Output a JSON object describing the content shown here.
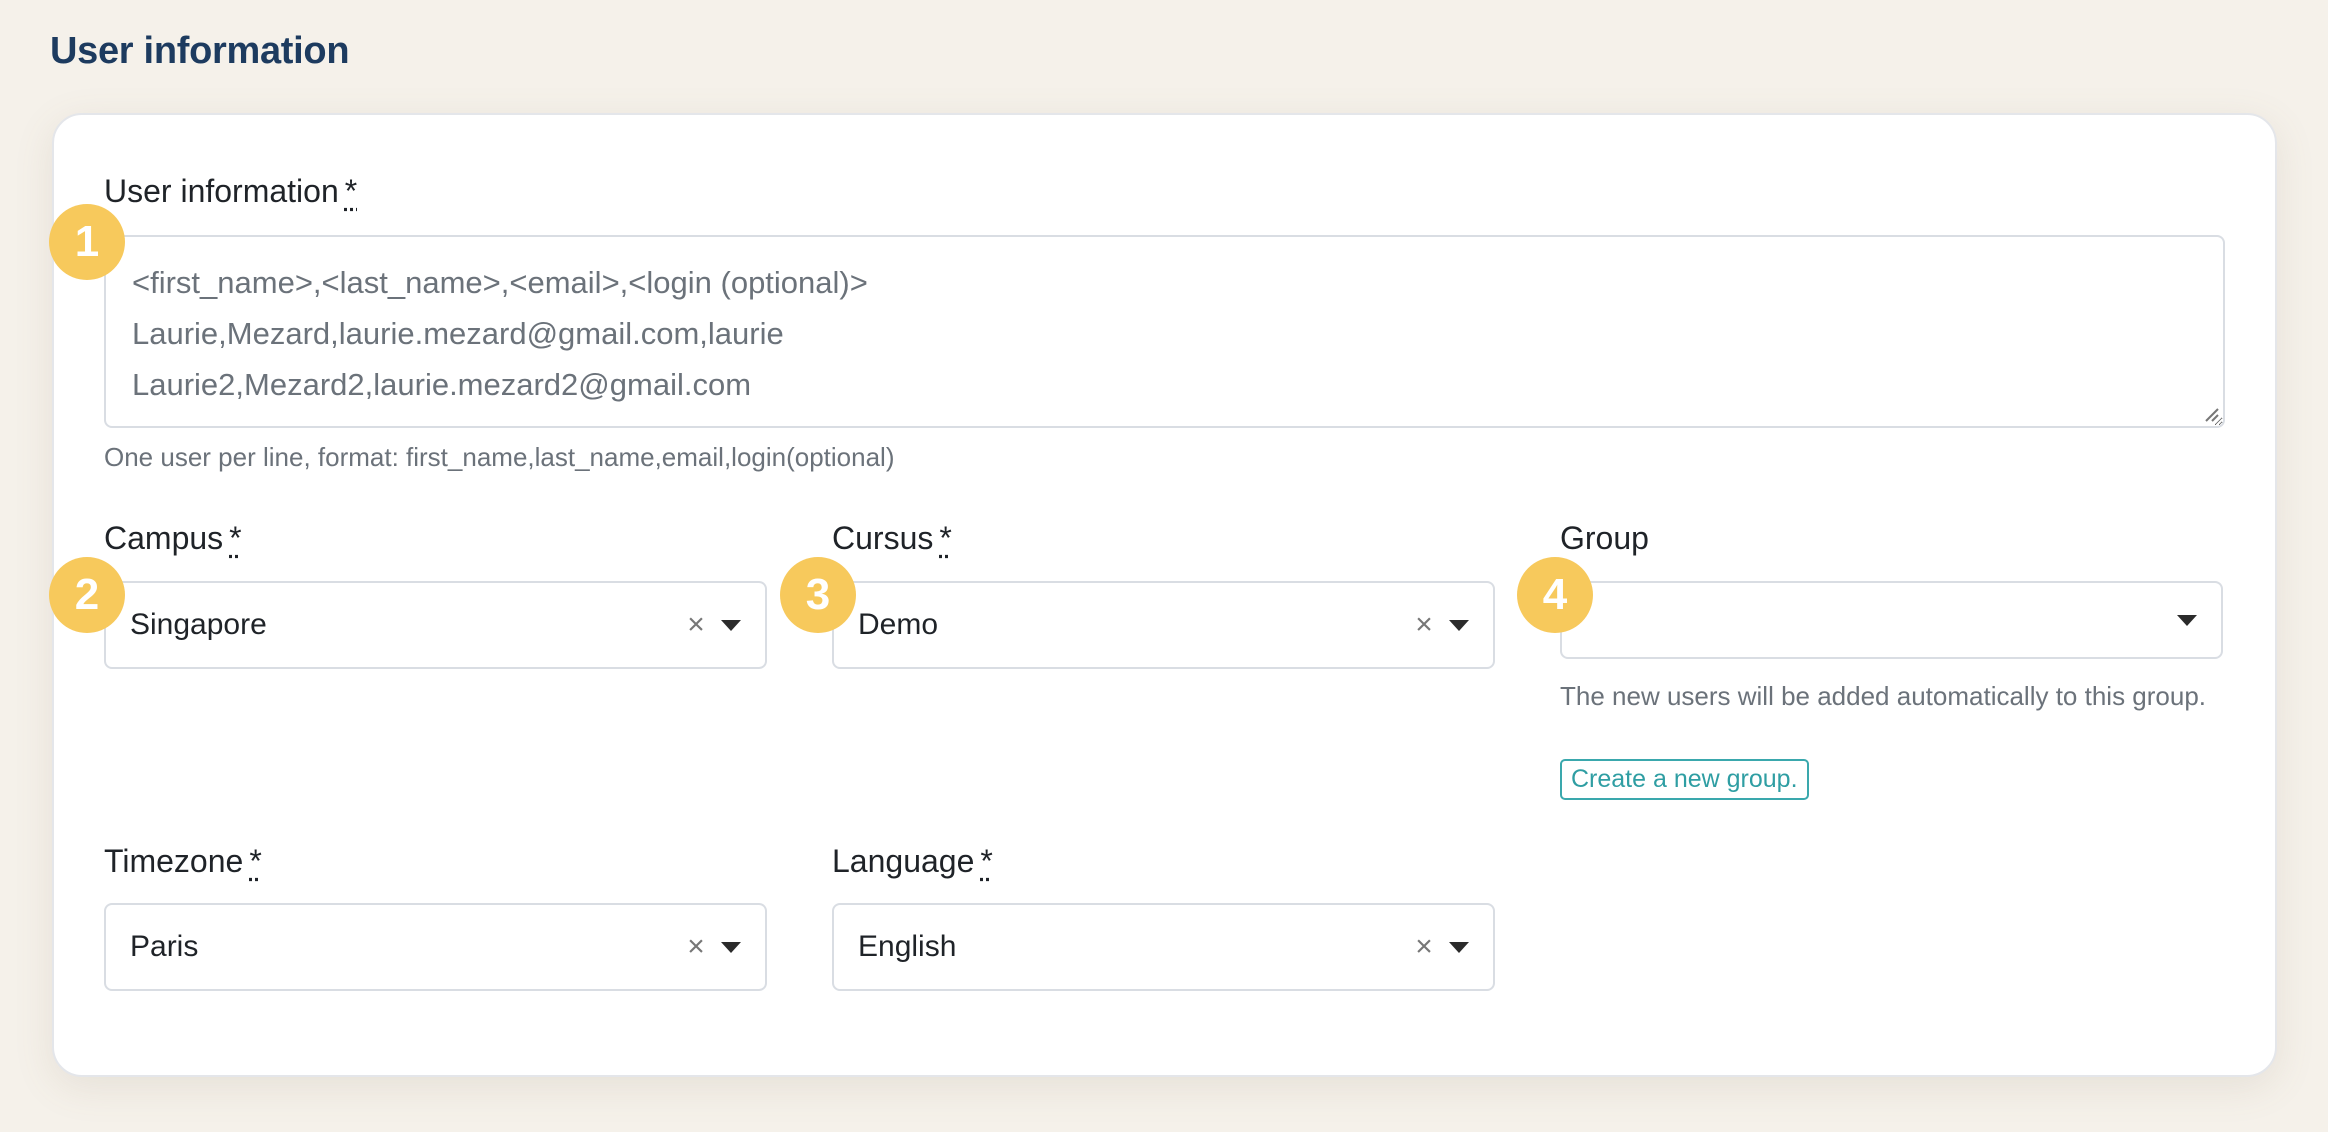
{
  "page": {
    "title": "User information"
  },
  "user_info": {
    "label": "User information",
    "required_mark": "*",
    "lines": [
      "<first_name>,<last_name>,<email>,<login (optional)>",
      "Laurie,Mezard,laurie.mezard@gmail.com,laurie",
      "Laurie2,Mezard2,laurie.mezard2@gmail.com"
    ],
    "help": "One user per line, format: first_name,last_name,email,login(optional)"
  },
  "campus": {
    "label": "Campus",
    "required_mark": "*",
    "value": "Singapore",
    "clear_icon": "×"
  },
  "cursus": {
    "label": "Cursus",
    "required_mark": "*",
    "value": "Demo",
    "clear_icon": "×"
  },
  "group": {
    "label": "Group",
    "value": "",
    "help": "The new users will be added automatically to this group.",
    "create_link": "Create a new group."
  },
  "timezone": {
    "label": "Timezone",
    "required_mark": "*",
    "value": "Paris",
    "clear_icon": "×"
  },
  "language": {
    "label": "Language",
    "required_mark": "*",
    "value": "English",
    "clear_icon": "×"
  },
  "badges": [
    "1",
    "2",
    "3",
    "4"
  ],
  "colors": {
    "accent_badge": "#f7c95c",
    "title": "#1d3b5f",
    "link": "#2f9ea3"
  }
}
